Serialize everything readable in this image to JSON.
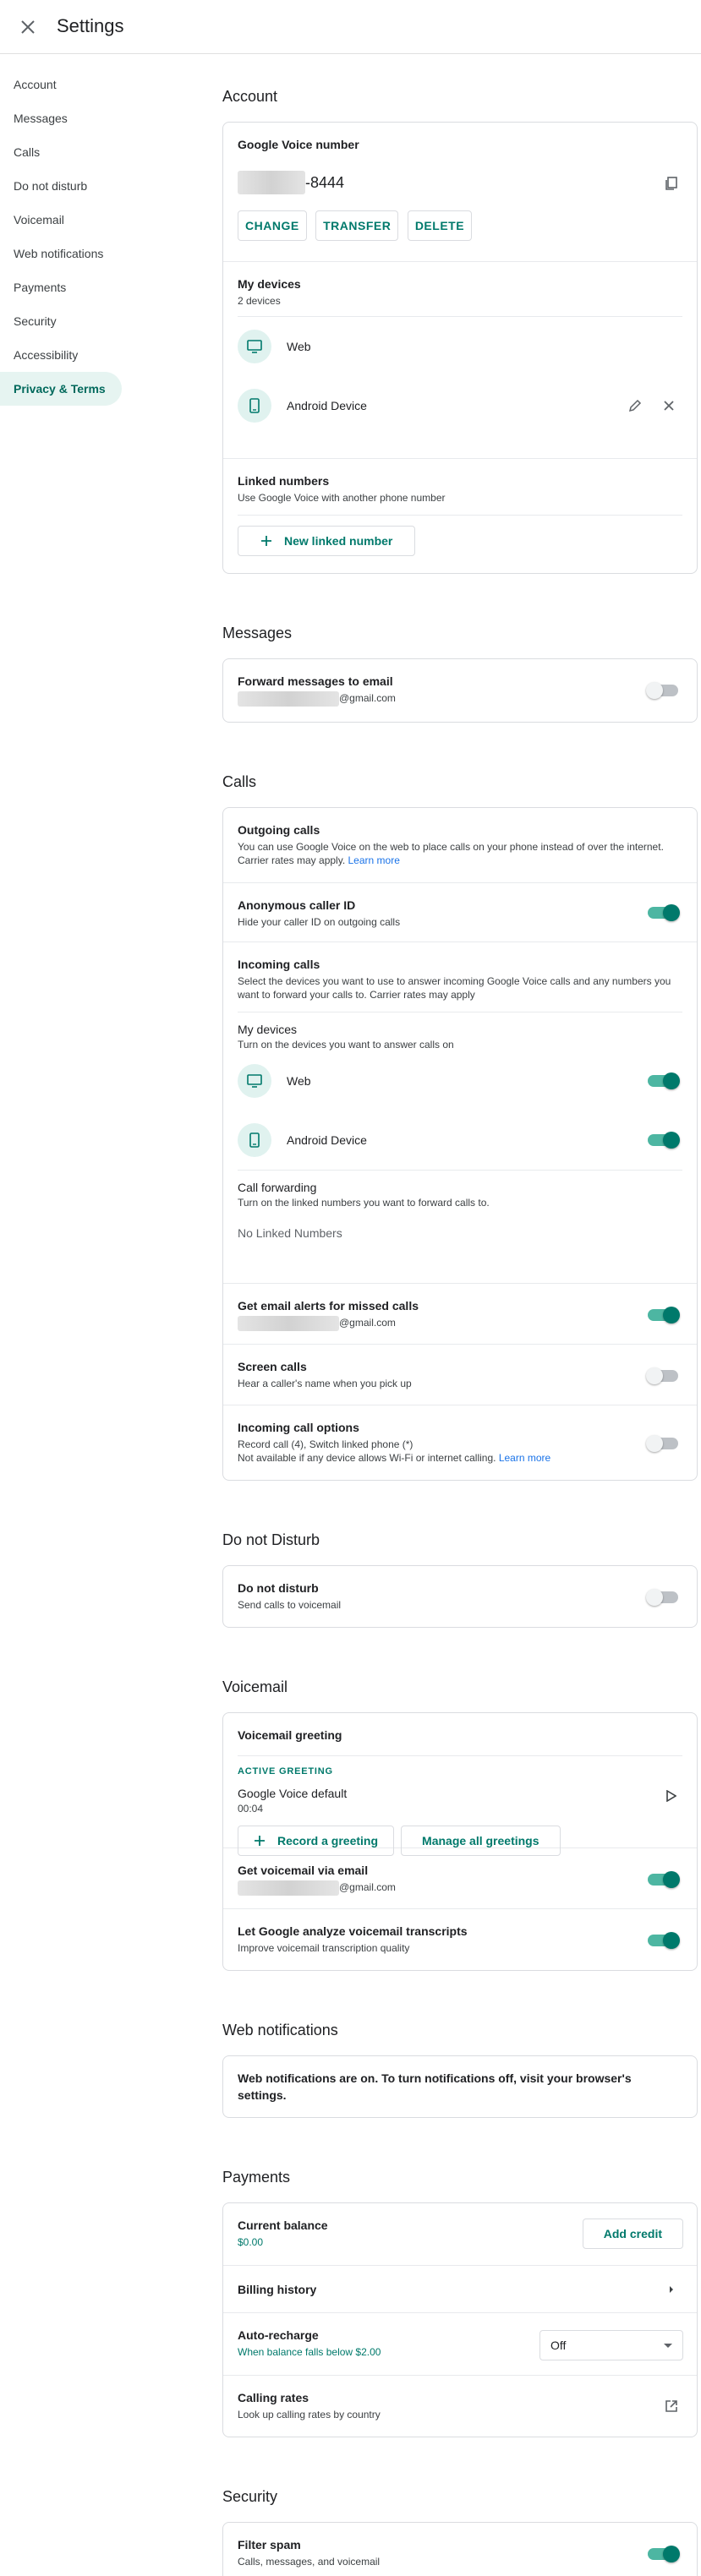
{
  "header": {
    "title": "Settings"
  },
  "sidebar": {
    "items": [
      {
        "label": "Account"
      },
      {
        "label": "Messages"
      },
      {
        "label": "Calls"
      },
      {
        "label": "Do not disturb"
      },
      {
        "label": "Voicemail"
      },
      {
        "label": "Web notifications"
      },
      {
        "label": "Payments"
      },
      {
        "label": "Security"
      },
      {
        "label": "Accessibility"
      },
      {
        "label": "Privacy & Terms"
      }
    ]
  },
  "account": {
    "section_title": "Account",
    "gv_number": {
      "title": "Google Voice number",
      "number_suffix": "-8444",
      "change": "CHANGE",
      "transfer": "TRANSFER",
      "delete": "DELETE"
    },
    "my_devices": {
      "title": "My devices",
      "count": "2 devices",
      "web": "Web",
      "android": "Android Device"
    },
    "linked": {
      "title": "Linked numbers",
      "sub": "Use Google Voice with another phone number",
      "new_button": "New linked number"
    }
  },
  "messages": {
    "section_title": "Messages",
    "forward": {
      "title": "Forward messages to email",
      "email_suffix": "@gmail.com",
      "enabled": false
    }
  },
  "calls": {
    "section_title": "Calls",
    "outgoing": {
      "title": "Outgoing calls",
      "sub": "You can use Google Voice on the web to place calls on your phone instead of over the internet. Carrier rates may apply.",
      "learn_more": "Learn more"
    },
    "anon": {
      "title": "Anonymous caller ID",
      "sub": "Hide your caller ID on outgoing calls",
      "enabled": true
    },
    "incoming": {
      "title": "Incoming calls",
      "sub": "Select the devices you want to use to answer incoming Google Voice calls and any numbers you want to forward your calls to. Carrier rates may apply"
    },
    "devices": {
      "title": "My devices",
      "sub": "Turn on the devices you want to answer calls on",
      "web": "Web",
      "android": "Android Device"
    },
    "forwarding": {
      "title": "Call forwarding",
      "sub": "Turn on the linked numbers you want to forward calls to.",
      "empty": "No Linked Numbers"
    },
    "missed_alerts": {
      "title": "Get email alerts for missed calls",
      "email_suffix": "@gmail.com",
      "enabled": true
    },
    "screen": {
      "title": "Screen calls",
      "sub": "Hear a caller's name when you pick up",
      "enabled": false
    },
    "options": {
      "title": "Incoming call options",
      "line1": "Record call (4), Switch linked phone (*)",
      "line2": "Not available if any device allows Wi-Fi or internet calling.",
      "learn_more": "Learn more",
      "enabled": false
    }
  },
  "dnd": {
    "section_title": "Do not Disturb",
    "item": {
      "title": "Do not disturb",
      "sub": "Send calls to voicemail",
      "enabled": false
    }
  },
  "voicemail": {
    "section_title": "Voicemail",
    "greeting": {
      "title": "Voicemail greeting",
      "active_label": "ACTIVE GREETING",
      "name": "Google Voice default",
      "duration": "00:04",
      "record": "Record a greeting",
      "manage": "Manage all greetings"
    },
    "via_email": {
      "title": "Get voicemail via email",
      "email_suffix": "@gmail.com",
      "enabled": true
    },
    "transcripts": {
      "title": "Let Google analyze voicemail transcripts",
      "sub": "Improve voicemail transcription quality",
      "enabled": true
    }
  },
  "web_notifications": {
    "section_title": "Web notifications",
    "text": "Web notifications are on. To turn notifications off, visit your browser's settings."
  },
  "payments": {
    "section_title": "Payments",
    "balance": {
      "title": "Current balance",
      "amount": "$0.00",
      "add_credit": "Add credit"
    },
    "billing": {
      "title": "Billing history"
    },
    "auto_recharge": {
      "title": "Auto-recharge",
      "sub": "When balance falls below $2.00",
      "value": "Off"
    },
    "rates": {
      "title": "Calling rates",
      "sub": "Look up calling rates by country"
    }
  },
  "security": {
    "section_title": "Security",
    "spam": {
      "title": "Filter spam",
      "sub": "Calls, messages, and voicemail",
      "enabled": true
    }
  },
  "colors": {
    "accent": "#00796b",
    "accent_light": "#e0f2ef",
    "link": "#1a73e8",
    "divider": "#dadce0"
  }
}
